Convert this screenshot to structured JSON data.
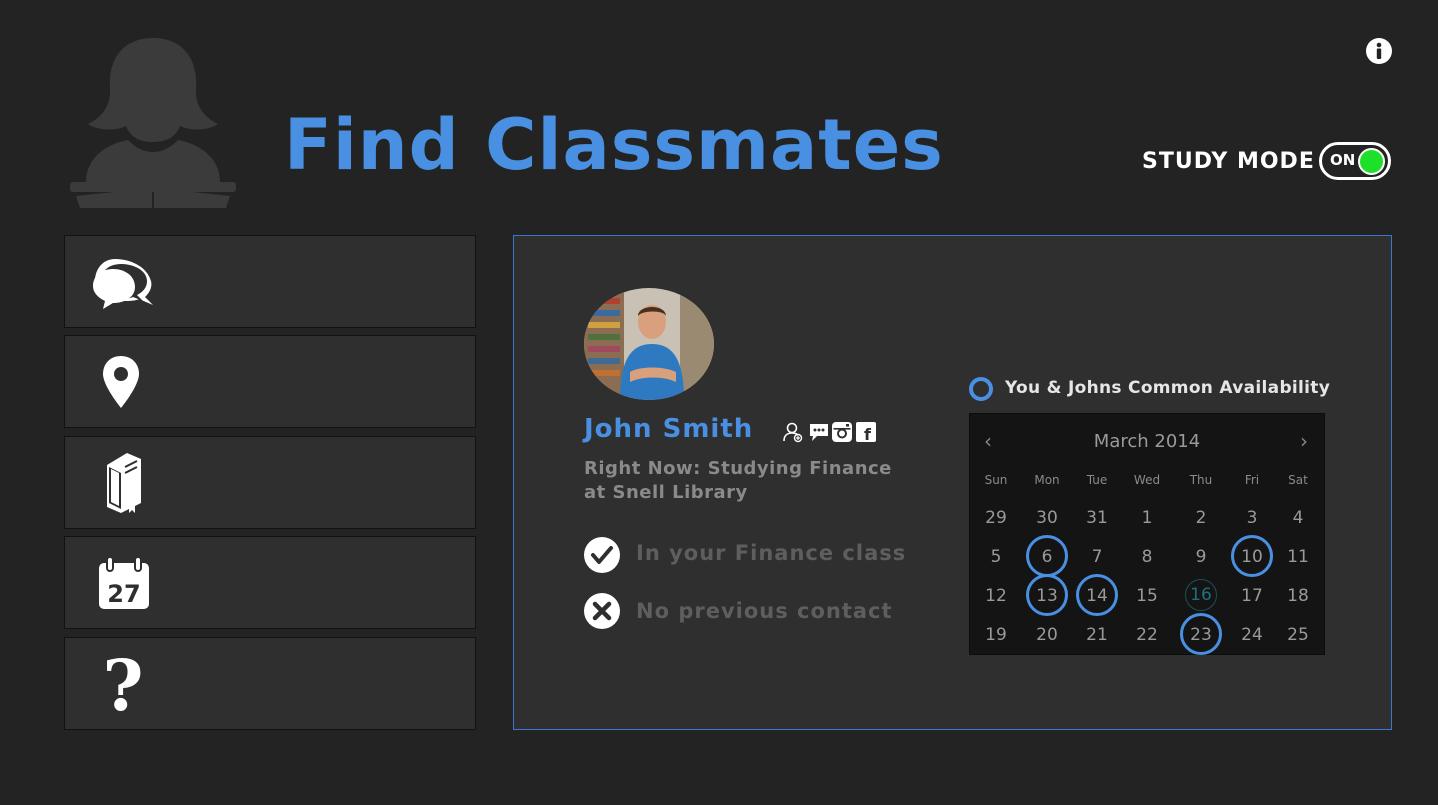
{
  "header": {
    "title": "Find Classmates",
    "study_mode_label": "STUDY MODE",
    "study_mode_toggle": "ON",
    "toggle_color": "#1ee02b",
    "accent_color": "#4a90e2"
  },
  "icons": {
    "logo": "student-reading-icon",
    "info": "info-icon"
  },
  "sidebar": {
    "items": [
      {
        "name": "chat",
        "icon": "chat-bubbles-icon"
      },
      {
        "name": "location",
        "icon": "map-pin-icon"
      },
      {
        "name": "courses",
        "icon": "book-icon"
      },
      {
        "name": "calendar",
        "icon": "calendar-icon",
        "icon_text": "27"
      },
      {
        "name": "help",
        "icon": "question-mark-icon",
        "icon_text": "?"
      }
    ]
  },
  "profile": {
    "name": "John Smith",
    "status_line1": "Right Now: Studying Finance",
    "status_line2": "at Snell Library",
    "socials": [
      "add-contact-icon",
      "message-icon",
      "instagram-icon",
      "facebook-icon"
    ],
    "facebook_glyph": "f",
    "checks": [
      {
        "state": "yes",
        "icon": "checkmark-icon",
        "text": "In your Finance class"
      },
      {
        "state": "no",
        "icon": "x-icon",
        "text": "No previous contact"
      }
    ]
  },
  "availability": {
    "legend": "You & Johns Common Availability",
    "calendar": {
      "month_label": "March 2014",
      "prev": "‹",
      "next": "›",
      "weekdays": [
        "Sun",
        "Mon",
        "Tue",
        "Wed",
        "Thu",
        "Fri",
        "Sat"
      ],
      "weeks": [
        [
          "29",
          "30",
          "31",
          "1",
          "2",
          "3",
          "4"
        ],
        [
          "5",
          "6",
          "7",
          "8",
          "9",
          "10",
          "11"
        ],
        [
          "12",
          "13",
          "14",
          "15",
          "16",
          "17",
          "18"
        ],
        [
          "19",
          "20",
          "21",
          "22",
          "23",
          "24",
          "25"
        ]
      ],
      "available_days": [
        "6",
        "10",
        "13",
        "14",
        "23"
      ],
      "today": "16"
    }
  }
}
